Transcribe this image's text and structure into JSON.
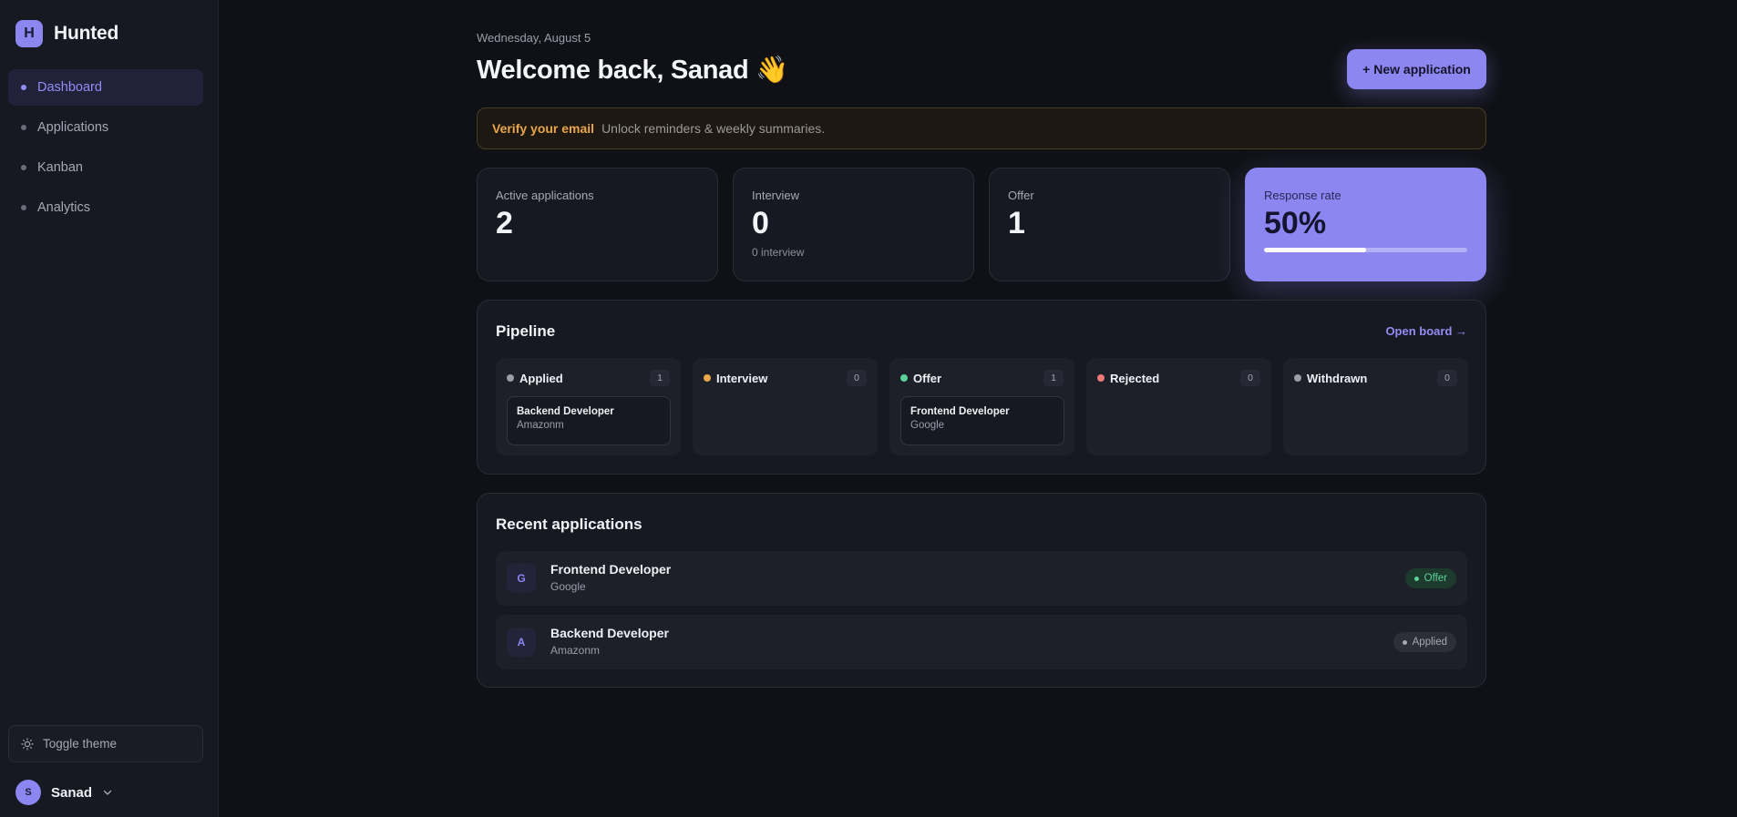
{
  "brand": {
    "logo_letter": "H",
    "name": "Hunted",
    "accent": "#8b86f0"
  },
  "sidebar": {
    "items": [
      {
        "label": "Dashboard",
        "active": true
      },
      {
        "label": "Applications",
        "active": false
      },
      {
        "label": "Kanban",
        "active": false
      },
      {
        "label": "Analytics",
        "active": false
      }
    ],
    "toggle_theme": "Toggle theme",
    "user": {
      "initial": "S",
      "name": "Sanad"
    }
  },
  "header": {
    "date": "Wednesday, August 5",
    "welcome": "Welcome back, Sanad 👋",
    "new_application": "+ New application"
  },
  "banner": {
    "strong": "Verify your email",
    "text": "Unlock reminders & weekly summaries."
  },
  "stats": {
    "active": {
      "label": "Active applications",
      "value": "2"
    },
    "interview": {
      "label": "Interview",
      "value": "0",
      "sub": "0 interview"
    },
    "offer": {
      "label": "Offer",
      "value": "1"
    },
    "response": {
      "label": "Response rate",
      "value": "50%",
      "progress": 0.5
    }
  },
  "pipeline": {
    "title": "Pipeline",
    "open_board": "Open board →",
    "columns": [
      {
        "name": "Applied",
        "count": "1",
        "color": "#9a9daa",
        "card": {
          "title": "Backend Developer",
          "company": "Amazonm"
        }
      },
      {
        "name": "Interview",
        "count": "0",
        "color": "#e9a64a"
      },
      {
        "name": "Offer",
        "count": "1",
        "color": "#5bd29a",
        "card": {
          "title": "Frontend Developer",
          "company": "Google"
        }
      },
      {
        "name": "Rejected",
        "count": "0",
        "color": "#f07a7a"
      },
      {
        "name": "Withdrawn",
        "count": "0",
        "color": "#9a9daa"
      }
    ]
  },
  "recent": {
    "title": "Recent applications",
    "rows": [
      {
        "initial": "G",
        "title": "Frontend Developer",
        "company": "Google",
        "status": "Offer"
      },
      {
        "initial": "A",
        "title": "Backend Developer",
        "company": "Amazonm",
        "status": "Applied"
      }
    ]
  }
}
